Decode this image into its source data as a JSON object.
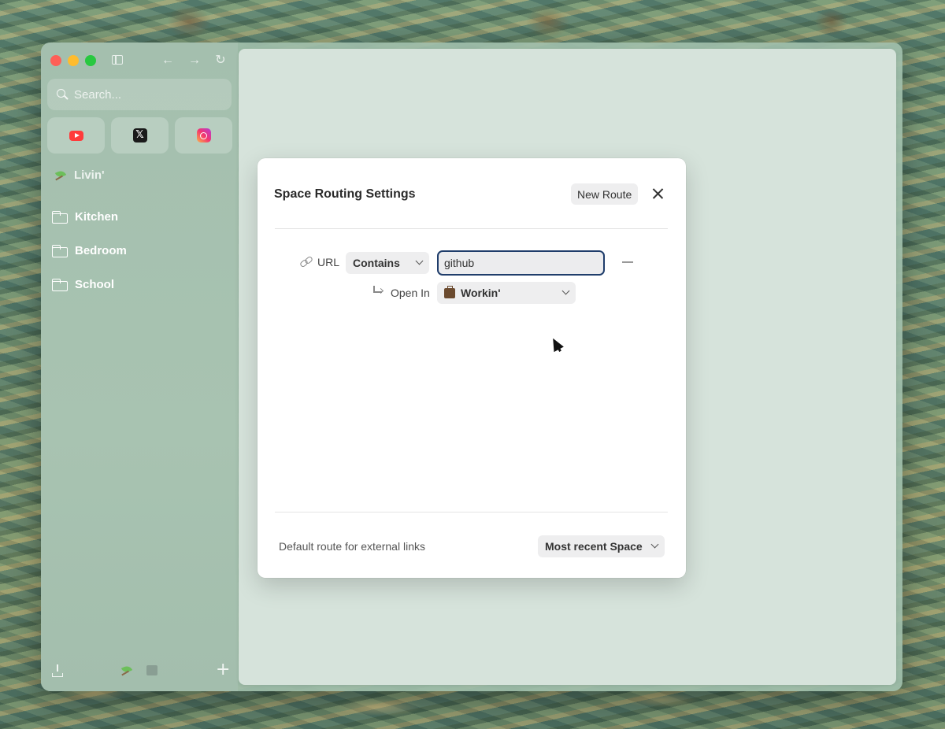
{
  "sidebar": {
    "search_placeholder": "Search...",
    "pinned": [
      {
        "name": "YouTube",
        "icon": "youtube-icon"
      },
      {
        "name": "X",
        "icon": "x-icon"
      },
      {
        "name": "Instagram",
        "icon": "instagram-icon"
      }
    ],
    "space_title": "Livin'",
    "folders": [
      "Kitchen",
      "Bedroom",
      "School"
    ]
  },
  "dialog": {
    "title": "Space Routing Settings",
    "new_route_label": "New Route",
    "route": {
      "field_label": "URL",
      "match_type": "Contains",
      "value": "github",
      "open_in_label": "Open In",
      "open_in_space": "Workin'"
    },
    "default_route_label": "Default route for external links",
    "default_route_value": "Most recent Space"
  },
  "colors": {
    "traffic_red": "#fe5f57",
    "traffic_yellow": "#febc2e",
    "traffic_green": "#28c840",
    "input_focus_border": "#1f3d6b"
  }
}
